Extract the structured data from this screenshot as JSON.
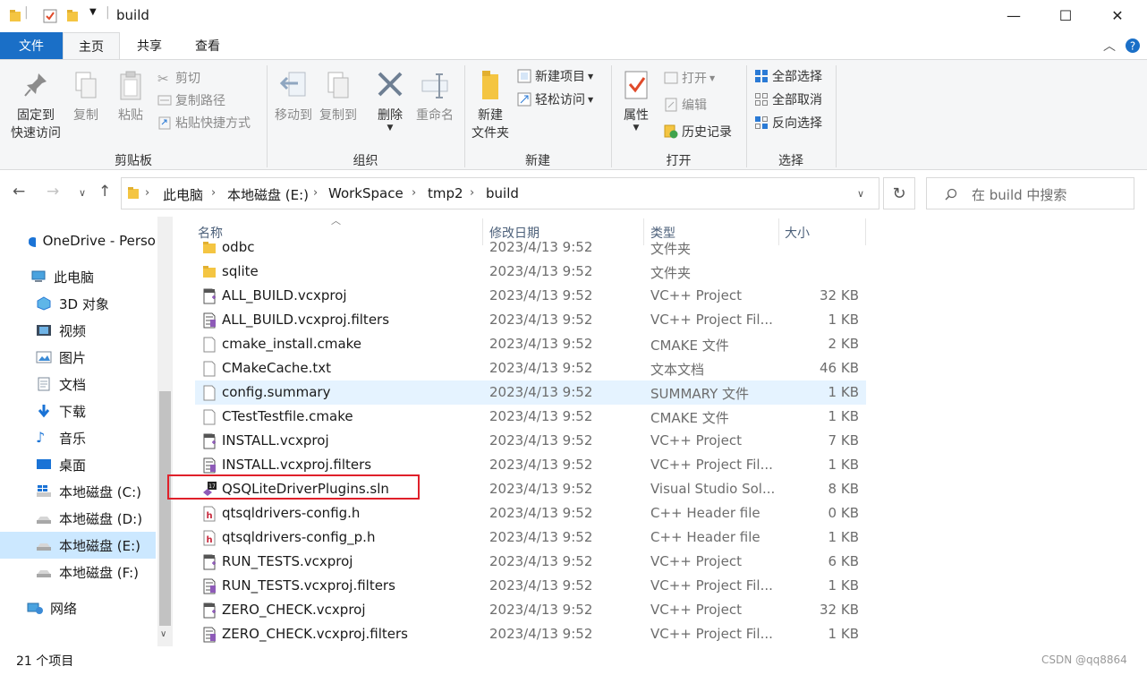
{
  "window": {
    "title": "build"
  },
  "tabs": [
    {
      "label": "文件"
    },
    {
      "label": "主页"
    },
    {
      "label": "共享"
    },
    {
      "label": "查看"
    }
  ],
  "ribbon": {
    "clipboard": {
      "label": "剪贴板",
      "pin": "固定到\n快速访问",
      "copy": "复制",
      "paste": "粘贴",
      "cut": "剪切",
      "copy_path": "复制路径",
      "paste_shortcut": "粘贴快捷方式"
    },
    "organize": {
      "label": "组织",
      "move_to": "移动到",
      "copy_to": "复制到",
      "delete": "删除",
      "rename": "重命名"
    },
    "new": {
      "label": "新建",
      "new_folder": "新建\n文件夹",
      "new_item": "新建项目",
      "easy_access": "轻松访问"
    },
    "open": {
      "label": "打开",
      "properties": "属性",
      "open": "打开",
      "edit": "编辑",
      "history": "历史记录"
    },
    "select": {
      "label": "选择",
      "select_all": "全部选择",
      "select_none": "全部取消",
      "invert": "反向选择"
    }
  },
  "address": {
    "crumbs": [
      "此电脑",
      "本地磁盘 (E:)",
      "WorkSpace",
      "tmp2",
      "build"
    ]
  },
  "search": {
    "placeholder": "在 build 中搜索"
  },
  "nav": [
    {
      "label": "OneDrive - Perso",
      "icon": "cloud-icon"
    },
    {
      "label": "此电脑",
      "icon": "computer-icon"
    },
    {
      "label": "3D 对象",
      "icon": "cube-icon"
    },
    {
      "label": "视频",
      "icon": "video-icon"
    },
    {
      "label": "图片",
      "icon": "picture-icon"
    },
    {
      "label": "文档",
      "icon": "document-icon"
    },
    {
      "label": "下载",
      "icon": "download-icon"
    },
    {
      "label": "音乐",
      "icon": "music-icon"
    },
    {
      "label": "桌面",
      "icon": "desktop-icon"
    },
    {
      "label": "本地磁盘 (C:)",
      "icon": "windows-drive-icon"
    },
    {
      "label": "本地磁盘 (D:)",
      "icon": "drive-icon"
    },
    {
      "label": "本地磁盘 (E:)",
      "icon": "drive-icon",
      "selected": true
    },
    {
      "label": "本地磁盘 (F:)",
      "icon": "drive-icon"
    },
    {
      "label": "网络",
      "icon": "network-icon"
    }
  ],
  "columns": {
    "name": "名称",
    "date": "修改日期",
    "type": "类型",
    "size": "大小"
  },
  "files": [
    {
      "name": "odbc",
      "date": "2023/4/13 9:52",
      "type": "文件夹",
      "size": "",
      "icon": "folder-icon"
    },
    {
      "name": "sqlite",
      "date": "2023/4/13 9:52",
      "type": "文件夹",
      "size": "",
      "icon": "folder-icon"
    },
    {
      "name": "ALL_BUILD.vcxproj",
      "date": "2023/4/13 9:52",
      "type": "VC++ Project",
      "size": "32 KB",
      "icon": "vcxproj-icon"
    },
    {
      "name": "ALL_BUILD.vcxproj.filters",
      "date": "2023/4/13 9:52",
      "type": "VC++ Project Fil...",
      "size": "1 KB",
      "icon": "filters-icon"
    },
    {
      "name": "cmake_install.cmake",
      "date": "2023/4/13 9:52",
      "type": "CMAKE 文件",
      "size": "2 KB",
      "icon": "file-icon"
    },
    {
      "name": "CMakeCache.txt",
      "date": "2023/4/13 9:52",
      "type": "文本文档",
      "size": "46 KB",
      "icon": "file-icon"
    },
    {
      "name": "config.summary",
      "date": "2023/4/13 9:52",
      "type": "SUMMARY 文件",
      "size": "1 KB",
      "icon": "file-icon",
      "hover": true
    },
    {
      "name": "CTestTestfile.cmake",
      "date": "2023/4/13 9:52",
      "type": "CMAKE 文件",
      "size": "1 KB",
      "icon": "file-icon"
    },
    {
      "name": "INSTALL.vcxproj",
      "date": "2023/4/13 9:52",
      "type": "VC++ Project",
      "size": "7 KB",
      "icon": "vcxproj-icon"
    },
    {
      "name": "INSTALL.vcxproj.filters",
      "date": "2023/4/13 9:52",
      "type": "VC++ Project Fil...",
      "size": "1 KB",
      "icon": "filters-icon"
    },
    {
      "name": "QSQLiteDriverPlugins.sln",
      "date": "2023/4/13 9:52",
      "type": "Visual Studio Sol...",
      "size": "8 KB",
      "icon": "sln-icon"
    },
    {
      "name": "qtsqldrivers-config.h",
      "date": "2023/4/13 9:52",
      "type": "C++ Header file",
      "size": "0 KB",
      "icon": "header-icon"
    },
    {
      "name": "qtsqldrivers-config_p.h",
      "date": "2023/4/13 9:52",
      "type": "C++ Header file",
      "size": "1 KB",
      "icon": "header-icon"
    },
    {
      "name": "RUN_TESTS.vcxproj",
      "date": "2023/4/13 9:52",
      "type": "VC++ Project",
      "size": "6 KB",
      "icon": "vcxproj-icon"
    },
    {
      "name": "RUN_TESTS.vcxproj.filters",
      "date": "2023/4/13 9:52",
      "type": "VC++ Project Fil...",
      "size": "1 KB",
      "icon": "filters-icon"
    },
    {
      "name": "ZERO_CHECK.vcxproj",
      "date": "2023/4/13 9:52",
      "type": "VC++ Project",
      "size": "32 KB",
      "icon": "vcxproj-icon"
    },
    {
      "name": "ZERO_CHECK.vcxproj.filters",
      "date": "2023/4/13 9:52",
      "type": "VC++ Project Fil...",
      "size": "1 KB",
      "icon": "filters-icon"
    }
  ],
  "status": {
    "count": "21 个项目",
    "watermark": "CSDN @qq8864"
  },
  "colors": {
    "file_tab": "#1a6fc7",
    "selection": "#cce8ff",
    "hover": "#e5f3ff",
    "highlight_box": "#e0202a"
  }
}
